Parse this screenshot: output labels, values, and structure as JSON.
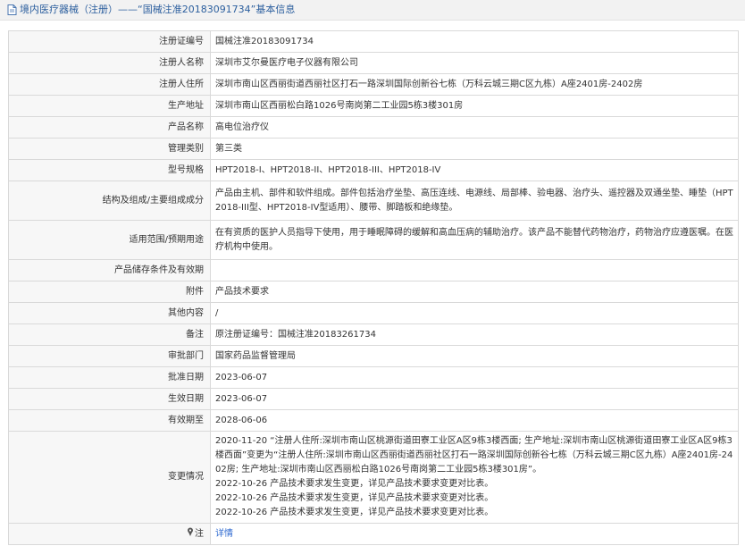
{
  "header": {
    "title": "境内医疗器械（注册）——“国械注准20183091734”基本信息",
    "icon": "document-icon"
  },
  "rows": [
    {
      "label": "注册证编号",
      "value": "国械注准20183091734"
    },
    {
      "label": "注册人名称",
      "value": "深圳市艾尔曼医疗电子仪器有限公司"
    },
    {
      "label": "注册人住所",
      "value": "深圳市南山区西丽街道西丽社区打石一路深圳国际创新谷七栋（万科云城三期C区九栋）A座2401房-2402房"
    },
    {
      "label": "生产地址",
      "value": "深圳市南山区西丽松白路1026号南岗第二工业园5栋3楼301房"
    },
    {
      "label": "产品名称",
      "value": "高电位治疗仪"
    },
    {
      "label": "管理类别",
      "value": "第三类"
    },
    {
      "label": "型号规格",
      "value": "HPT2018-I、HPT2018-II、HPT2018-III、HPT2018-IV"
    },
    {
      "label": "结构及组成/主要组成成分",
      "value": "产品由主机、部件和软件组成。部件包括治疗坐垫、高压连线、电源线、局部棒、验电器、治疗头、遥控器及双通坐垫、睡垫（HPT2018-III型、HPT2018-IV型适用）、腰带、脚踏板和绝缘垫。"
    },
    {
      "label": "适用范围/预期用途",
      "value": "在有资质的医护人员指导下使用，用于睡眠障碍的缓解和高血压病的辅助治疗。该产品不能替代药物治疗，药物治疗应遵医嘱。在医疗机构中使用。"
    },
    {
      "label": "产品储存条件及有效期",
      "value": ""
    },
    {
      "label": "附件",
      "value": "产品技术要求"
    },
    {
      "label": "其他内容",
      "value": "/"
    },
    {
      "label": "备注",
      "value": "原注册证编号：国械注准20183261734"
    },
    {
      "label": "审批部门",
      "value": "国家药品监督管理局"
    },
    {
      "label": "批准日期",
      "value": "2023-06-07"
    },
    {
      "label": "生效日期",
      "value": "2023-06-07"
    },
    {
      "label": "有效期至",
      "value": "2028-06-06"
    }
  ],
  "changes": {
    "label": "变更情况",
    "lines": [
      "2020-11-20 “注册人住所:深圳市南山区桃源街道田寮工业区A区9栋3楼西面; 生产地址:深圳市南山区桃源街道田寮工业区A区9栋3楼西面”变更为“注册人住所:深圳市南山区西丽街道西丽社区打石一路深圳国际创新谷七栋（万科云城三期C区九栋）A座2401房-2402房; 生产地址:深圳市南山区西丽松白路1026号南岗第二工业园5栋3楼301房”。",
      "2022-10-26 产品技术要求发生变更，详见产品技术要求变更对比表。",
      "2022-10-26 产品技术要求发生变更，详见产品技术要求变更对比表。",
      "2022-10-26 产品技术要求发生变更，详见产品技术要求变更对比表。"
    ]
  },
  "note": {
    "label": "注",
    "icon": "pin-icon",
    "link_text": "详情"
  }
}
